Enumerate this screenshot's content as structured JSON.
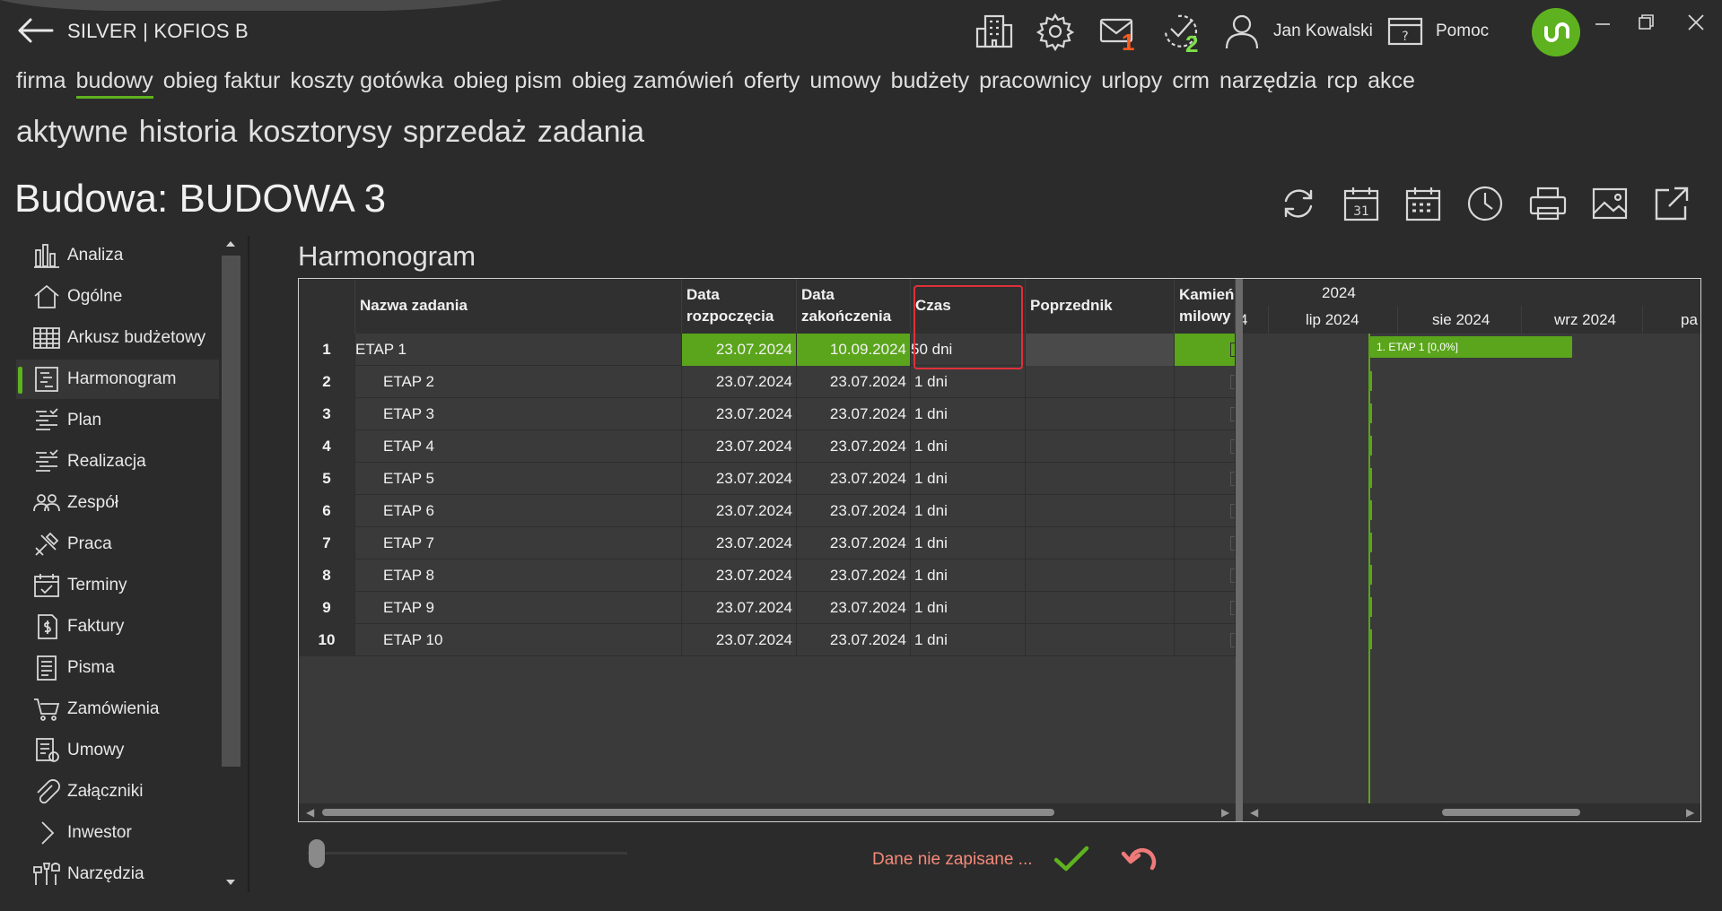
{
  "app": {
    "title": "SILVER | KOFIOS B",
    "user_name": "Jan Kowalski",
    "help_label": "Pomoc",
    "mail_badge": "1",
    "tasks_badge": "2",
    "accent": "#5fb21f",
    "mail_badge_color": "#ff5a1f",
    "tasks_badge_color": "#7ee04a"
  },
  "main_menu": [
    "firma",
    "budowy",
    "obieg faktur",
    "koszty gotówka",
    "obieg pism",
    "obieg zamówień",
    "oferty",
    "umowy",
    "budżety",
    "pracownicy",
    "urlopy",
    "crm",
    "narzędzia",
    "rcp",
    "akce"
  ],
  "main_menu_active": "budowy",
  "sub_menu": [
    "aktywne",
    "historia",
    "kosztorysy",
    "sprzedaż",
    "zadania"
  ],
  "page": {
    "title": "Budowa: BUDOWA 3"
  },
  "toolbar_icons": [
    "refresh-icon",
    "calendar-31-icon",
    "calendar-grid-icon",
    "clock-icon",
    "printer-icon",
    "image-icon",
    "open-external-icon"
  ],
  "sidebar": {
    "active": "Harmonogram",
    "items": [
      {
        "label": "Analiza",
        "icon": "bar-chart-icon"
      },
      {
        "label": "Ogólne",
        "icon": "home-icon"
      },
      {
        "label": "Arkusz budżetowy",
        "icon": "spreadsheet-icon"
      },
      {
        "label": "Harmonogram",
        "icon": "schedule-icon"
      },
      {
        "label": "Plan",
        "icon": "plan-list-icon"
      },
      {
        "label": "Realizacja",
        "icon": "checklist-icon"
      },
      {
        "label": "Zespół",
        "icon": "team-icon"
      },
      {
        "label": "Praca",
        "icon": "work-tools-icon"
      },
      {
        "label": "Terminy",
        "icon": "deadline-calendar-icon"
      },
      {
        "label": "Faktury",
        "icon": "invoice-icon"
      },
      {
        "label": "Pisma",
        "icon": "letter-icon"
      },
      {
        "label": "Zamówienia",
        "icon": "cart-icon"
      },
      {
        "label": "Umowy",
        "icon": "contract-icon"
      },
      {
        "label": "Załączniki",
        "icon": "paperclip-icon"
      },
      {
        "label": "Inwestor",
        "icon": "chevron-right-icon"
      },
      {
        "label": "Narzędzia",
        "icon": "tools-icon"
      }
    ]
  },
  "schedule": {
    "title": "Harmonogram",
    "columns": {
      "name": "Nazwa zadania",
      "start": [
        "Data",
        "rozpoczęcia"
      ],
      "end": [
        "Data",
        "zakończenia"
      ],
      "duration": "Czas",
      "predecessor": "Poprzednik",
      "milestone": [
        "Kamień",
        "milowy"
      ]
    },
    "rows": [
      {
        "no": "1",
        "name": "ETAP 1",
        "start": "23.07.2024",
        "end": "10.09.2024",
        "duration": "50 dni",
        "selected": true
      },
      {
        "no": "2",
        "name": "ETAP 2",
        "start": "23.07.2024",
        "end": "23.07.2024",
        "duration": "1 dni"
      },
      {
        "no": "3",
        "name": "ETAP 3",
        "start": "23.07.2024",
        "end": "23.07.2024",
        "duration": "1 dni"
      },
      {
        "no": "4",
        "name": "ETAP 4",
        "start": "23.07.2024",
        "end": "23.07.2024",
        "duration": "1 dni"
      },
      {
        "no": "5",
        "name": "ETAP 5",
        "start": "23.07.2024",
        "end": "23.07.2024",
        "duration": "1 dni"
      },
      {
        "no": "6",
        "name": "ETAP 6",
        "start": "23.07.2024",
        "end": "23.07.2024",
        "duration": "1 dni"
      },
      {
        "no": "7",
        "name": "ETAP 7",
        "start": "23.07.2024",
        "end": "23.07.2024",
        "duration": "1 dni"
      },
      {
        "no": "8",
        "name": "ETAP 8",
        "start": "23.07.2024",
        "end": "23.07.2024",
        "duration": "1 dni"
      },
      {
        "no": "9",
        "name": "ETAP 9",
        "start": "23.07.2024",
        "end": "23.07.2024",
        "duration": "1 dni"
      },
      {
        "no": "10",
        "name": "ETAP 10",
        "start": "23.07.2024",
        "end": "23.07.2024",
        "duration": "1 dni"
      }
    ],
    "gantt": {
      "year": "2024",
      "first_partial": "4",
      "months": [
        "lip 2024",
        "sie 2024",
        "wrz 2024",
        "pa"
      ],
      "bar_label": "1. ETAP 1 [0,0%]"
    }
  },
  "status": {
    "message": "Dane nie zapisane ..."
  }
}
